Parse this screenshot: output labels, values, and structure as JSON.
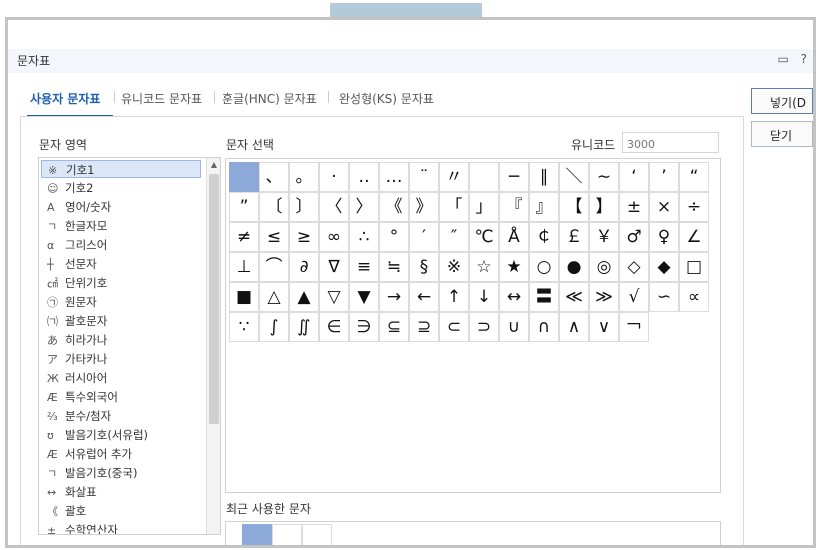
{
  "window": {
    "title": "문자표",
    "icons": [
      "comment-icon",
      "help-icon"
    ],
    "help_glyph": "?"
  },
  "tabs": [
    {
      "label": "사용자 문자표",
      "active": true
    },
    {
      "label": "유니코드 문자표",
      "active": false
    },
    {
      "label": "훈글(HNC) 문자표",
      "active": false
    },
    {
      "label": "완성형(KS) 문자표",
      "active": false
    }
  ],
  "buttons": {
    "insert": "넣기(D",
    "close": "닫기"
  },
  "left": {
    "title": "문자 영역",
    "items": [
      {
        "icon": "※",
        "label": "기호1",
        "selected": true
      },
      {
        "icon": "☺",
        "label": "기호2"
      },
      {
        "icon": "A",
        "label": "영어/숫자"
      },
      {
        "icon": "ㄱ",
        "label": "한글자모"
      },
      {
        "icon": "α",
        "label": "그리스어"
      },
      {
        "icon": "┼",
        "label": "선문자"
      },
      {
        "icon": "㎠",
        "label": "단위기호"
      },
      {
        "icon": "㉠",
        "label": "원문자"
      },
      {
        "icon": "㈀",
        "label": "괄호문자"
      },
      {
        "icon": "あ",
        "label": "히라가나"
      },
      {
        "icon": "ア",
        "label": "가타카나"
      },
      {
        "icon": "Ж",
        "label": "러시아어"
      },
      {
        "icon": "Æ",
        "label": "특수외국어"
      },
      {
        "icon": "⅔",
        "label": "분수/첨자"
      },
      {
        "icon": "ʊ",
        "label": "발음기호(서유럽)"
      },
      {
        "icon": "Æ",
        "label": "서유럽어 추가"
      },
      {
        "icon": "ㄱ",
        "label": "발음기호(중국)"
      },
      {
        "icon": "↔",
        "label": "화살표"
      },
      {
        "icon": "《",
        "label": "괄호"
      },
      {
        "icon": "±",
        "label": "수학연산자"
      }
    ]
  },
  "main": {
    "title": "문자 선택",
    "unicode_label": "유니코드",
    "unicode_placeholder": "3000",
    "rows": [
      [
        "",
        "、",
        "。",
        "·",
        "‥",
        "…",
        "¨",
        "〃",
        "",
        "─",
        "∥",
        "＼",
        "∼",
        "‘",
        "’",
        "“"
      ],
      [
        "”",
        "〔",
        "〕",
        "〈",
        "〉",
        "《",
        "》",
        "「",
        "」",
        "『",
        "』",
        "【",
        "】",
        "±",
        "×",
        "÷"
      ],
      [
        "≠",
        "≤",
        "≥",
        "∞",
        "∴",
        "°",
        "′",
        "″",
        "℃",
        "Å",
        "￠",
        "￡",
        "￥",
        "♂",
        "♀",
        "∠"
      ],
      [
        "⊥",
        "⌒",
        "∂",
        "∇",
        "≡",
        "≒",
        "§",
        "※",
        "☆",
        "★",
        "○",
        "●",
        "◎",
        "◇",
        "◆",
        "□"
      ],
      [
        "■",
        "△",
        "▲",
        "▽",
        "▼",
        "→",
        "←",
        "↑",
        "↓",
        "↔",
        "〓",
        "≪",
        "≫",
        "√",
        "∽",
        "∝"
      ],
      [
        "∵",
        "∫",
        "∬",
        "∈",
        "∋",
        "⊆",
        "⊇",
        "⊂",
        "⊃",
        "∪",
        "∩",
        "∧",
        "∨",
        "￢"
      ]
    ]
  },
  "recent": {
    "title": "최근 사용한 문자"
  }
}
